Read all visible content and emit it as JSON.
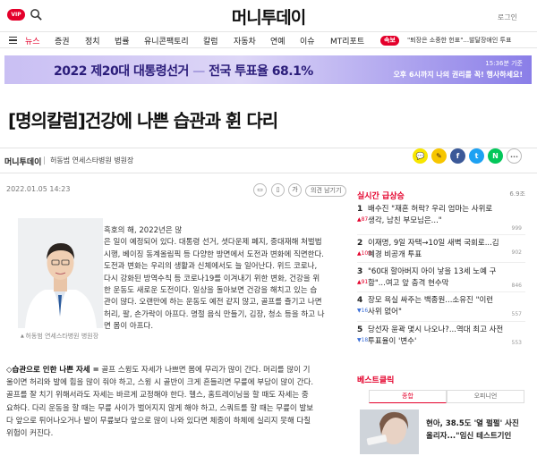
{
  "header": {
    "vip": "VIP",
    "logo": "머니투데이",
    "login": "로그인"
  },
  "nav": {
    "items": [
      "뉴스",
      "증권",
      "정치",
      "법률",
      "유니콘팩토리",
      "칼럼",
      "자동차",
      "연예",
      "이슈",
      "MT리포트"
    ],
    "active_index": 0,
    "breaking_badge": "속보",
    "breaking_text": "\"퇴장은 소중한 헌표\"...발달장애인 투표"
  },
  "banner": {
    "title": "2022 제20대 대통령선거",
    "dash": "—",
    "turnout_label": "전국 투표율",
    "turnout_value": "68.1%",
    "time": "15:36분 기준",
    "subtitle": "오후 6시까지 나의 권리를 꼭! 행사하세요!"
  },
  "article": {
    "headline": "[명의칼럼]건강에 나쁜 습관과 휜 다리",
    "publisher": "머니투데이",
    "author": "허동범 연세스타병원 병원장",
    "date": "2022.01.05 14:23",
    "tools": [
      "인쇄",
      "스크랩",
      "가"
    ],
    "opinion": "의견 남기기",
    "caption": "허동범 연세스타병원 병원장",
    "para1": [
      "흑호의 해, 2022년은 많",
      "은 일이 예정되어 있다. 대통령 선거, 셧다운제 폐지, 중대재해 처벌법",
      "시행, 베이징 동계올림픽 등 다양한 방면에서 도전과 변화에 직면한다.",
      "도전과 변화는 우리의 생활과 신체에서도 늘 일어난다. 위드 코로나,",
      "다시 강화된 방역수칙 등 코로나19를 이겨내기 위한 변화, 건강을 위",
      "한 운동도 새로운 도전이다. 일상을 돌아보면 건강을 해치고 있는 습",
      "관이 많다. 오랜만에 하는 운동도 예전 같지 않고, 골프를 즐기고 나면",
      "허리, 팔, 손가락이 아프다. 명절 음식 만들기, 김장, 청소 등을 하고 나",
      "면 몸이 아프다."
    ],
    "para2_lead": "◇습관으로 인한 나쁜 자세 =",
    "para2": [
      " 골프 스윙도 자세가 나쁘면 몸에 무리가 많이 간다. 머리를 많이 기",
      "울이면 허리와 발에 힘을 많이 줘야 하고, 스윙 시 골반이 크게 흔들리면 무릎에 부담이 많이 간다.",
      "골프를 잘 치기 위해서라도 자세는 바르게 교정해야 한다. 헬스, 홈트레이닝을 할 때도 자세는 중",
      "요하다. 다리 운동을 할 때는 무릎 사이가 벌어지지 않게 해야 하고, 스쿼트를 할 때는 무릎이 발보",
      "다 앞으로 튀어나오거나 발이 무릎보다 앞으로 많이 나와 있다면 체중이 하체에 실리지 못해 다칠",
      "위험이 커진다."
    ]
  },
  "sidebar": {
    "title": "실시간 급상승",
    "time": "6.9조",
    "items": [
      {
        "rank": "1",
        "change": "▲87",
        "dir": "up",
        "lines": [
          "배수진 \"재혼 허락? 우리 엄마는 사위로",
          "생각, 남친 부모님은...\""
        ],
        "meta": "999"
      },
      {
        "rank": "2",
        "change": "▲109",
        "dir": "up",
        "lines": [
          "이재명, 9일 자택→10일 새벽 국회로...김",
          "혜경 비공개 투표"
        ],
        "meta": "902"
      },
      {
        "rank": "3",
        "change": "▲91",
        "dir": "up",
        "lines": [
          "\"60대 할아버지 아이 낳을 13세 노예 구",
          "함\"...여고 앞 충격 현수막"
        ],
        "meta": "846"
      },
      {
        "rank": "4",
        "change": "▼16",
        "dir": "down",
        "lines": [
          "장모 욕실 싸주는 백종원...소유진 \"이런",
          "사위 없어\""
        ],
        "meta": "557"
      },
      {
        "rank": "5",
        "change": "▼18",
        "dir": "down",
        "lines": [
          "당선자 윤곽 몇시 나오나?...역대 최고 사전",
          "투표율이 '변수'"
        ],
        "meta": "553"
      }
    ],
    "best_title": "베스트클릭",
    "tabs": [
      "종합",
      "오피니언"
    ],
    "best_lines": [
      "현아, 38.5도 '열 펄펄' 사진",
      "올리자...\"임신 테스트기인"
    ]
  },
  "colors": {
    "brand_red": "#e4002b",
    "banner_text": "#2b1d7a"
  }
}
